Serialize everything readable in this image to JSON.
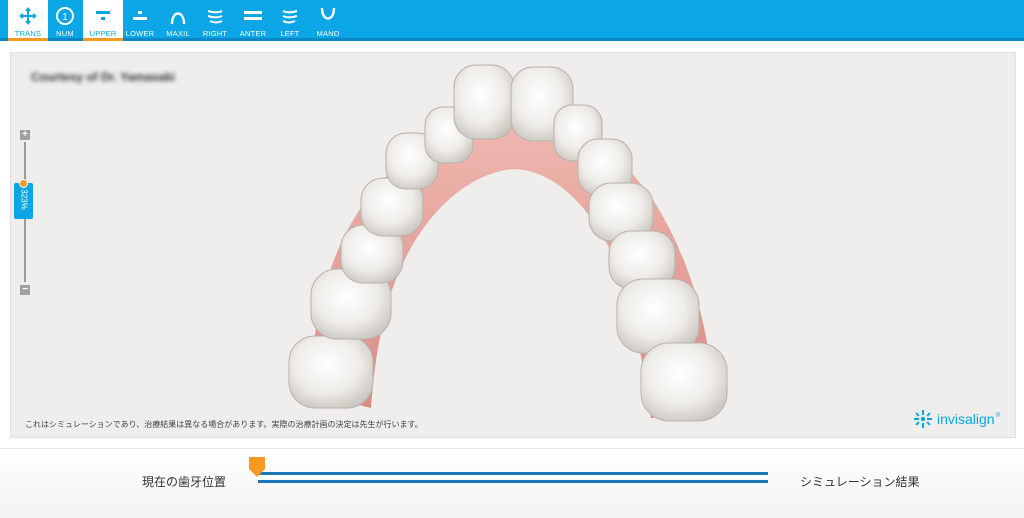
{
  "toolbar": {
    "items": [
      {
        "label": "TRANS",
        "icon": "move-arrows-icon",
        "active": true
      },
      {
        "label": "NUM",
        "icon": "numbered-circle-icon",
        "active": false
      },
      {
        "label": "UPPER",
        "icon": "upper-view-icon",
        "active": true
      },
      {
        "label": "LOWER",
        "icon": "lower-view-icon",
        "active": false
      },
      {
        "label": "MAXIL",
        "icon": "maxillary-arch-icon",
        "active": false
      },
      {
        "label": "RIGHT",
        "icon": "right-view-icon",
        "active": false
      },
      {
        "label": "ANTER",
        "icon": "anterior-view-icon",
        "active": false
      },
      {
        "label": "LEFT",
        "icon": "left-view-icon",
        "active": false
      },
      {
        "label": "MAND",
        "icon": "mandibular-arch-icon",
        "active": false
      }
    ],
    "num_badge": "1"
  },
  "viewer": {
    "courtesy": "Courtesy of Dr. Yamasaki",
    "disclaimer": "これはシミュレーションであり、治療結果は異なる場合があります。実際の治療計画の決定は先生が行います。",
    "logo": "invisalign",
    "logo_mark": "®"
  },
  "zoom": {
    "plus": "+",
    "minus": "−",
    "level": "323%"
  },
  "timeline": {
    "left_label": "現在の歯牙位置",
    "right_label": "シミュレーション結果",
    "position": 0
  },
  "colors": {
    "toolbar": "#0aa6e6",
    "accent": "#f59a23",
    "timeline": "#1b76b8"
  }
}
